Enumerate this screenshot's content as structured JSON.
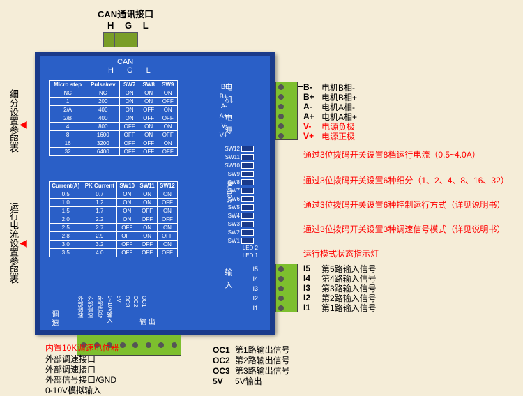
{
  "top": {
    "can": "CAN通讯接口",
    "hgl": "H G L"
  },
  "board": {
    "can": "CAN",
    "hgl": "H G L",
    "setting": "Setting"
  },
  "table_microstep": {
    "headers": [
      "Micro step",
      "Pulse/rev",
      "SW7",
      "SW8",
      "SW9"
    ],
    "rows": [
      [
        "NC",
        "NC",
        "ON",
        "ON",
        "ON"
      ],
      [
        "1",
        "200",
        "ON",
        "ON",
        "OFF"
      ],
      [
        "2/A",
        "400",
        "ON",
        "OFF",
        "ON"
      ],
      [
        "2/B",
        "400",
        "ON",
        "OFF",
        "OFF"
      ],
      [
        "4",
        "800",
        "OFF",
        "ON",
        "ON"
      ],
      [
        "8",
        "1600",
        "OFF",
        "ON",
        "OFF"
      ],
      [
        "16",
        "3200",
        "OFF",
        "OFF",
        "ON"
      ],
      [
        "32",
        "6400",
        "OFF",
        "OFF",
        "OFF"
      ]
    ]
  },
  "table_current": {
    "headers": [
      "Current(A)",
      "PK Current",
      "SW10",
      "SW11",
      "SW12"
    ],
    "rows": [
      [
        "0.5",
        "0.7",
        "ON",
        "ON",
        "ON"
      ],
      [
        "1.0",
        "1.2",
        "ON",
        "ON",
        "OFF"
      ],
      [
        "1.5",
        "1.7",
        "ON",
        "OFF",
        "ON"
      ],
      [
        "2.0",
        "2.2",
        "ON",
        "OFF",
        "OFF"
      ],
      [
        "2.5",
        "2.7",
        "OFF",
        "ON",
        "ON"
      ],
      [
        "2.8",
        "2.9",
        "OFF",
        "ON",
        "OFF"
      ],
      [
        "3.0",
        "3.2",
        "OFF",
        "OFF",
        "ON"
      ],
      [
        "3.5",
        "4.0",
        "OFF",
        "OFF",
        "OFF"
      ]
    ]
  },
  "motor_terms": [
    {
      "k": "B-",
      "d": "电机B相-"
    },
    {
      "k": "B+",
      "d": "电机B相+"
    },
    {
      "k": "A-",
      "d": "电机A相-"
    },
    {
      "k": "A+",
      "d": "电机A相+"
    },
    {
      "k": "V-",
      "d": "电源负极",
      "red": true
    },
    {
      "k": "V+",
      "d": "电源正极",
      "red": true
    }
  ],
  "sw_names": [
    "SW12",
    "SW11",
    "SW10",
    "SW9",
    "SW8",
    "SW7",
    "SW6",
    "SW5",
    "SW4",
    "SW3",
    "SW2",
    "SW1"
  ],
  "leds": [
    "LED 2",
    "LED 1"
  ],
  "sw_ann": [
    "通过3位拨码开关设置8档运行电流（0.5~4.0A）",
    "通过3位拨码开关设置6种细分（1、2、4、8、16、32）",
    "通过3位拨码开关设置6种控制运行方式（详见说明书）",
    "通过3位拨码开关设置3种调速信号模式（详见说明书）",
    "运行模式状态指示灯"
  ],
  "inputs": [
    {
      "k": "I5",
      "d": "第5路输入信号"
    },
    {
      "k": "I4",
      "d": "第4路输入信号"
    },
    {
      "k": "I3",
      "d": "第3路输入信号"
    },
    {
      "k": "I2",
      "d": "第2路输入信号"
    },
    {
      "k": "I1",
      "d": "第1路输入信号"
    }
  ],
  "board_io_input": [
    "I5",
    "I4",
    "I3",
    "I2",
    "I1"
  ],
  "board_cn": {
    "motor": "电 机",
    "power": "电 源",
    "input": "输 入",
    "speed": "调 速",
    "output": "输 出"
  },
  "btm_labels": [
    "外部调速",
    "外部调速",
    "外部信号",
    "0~10V输入",
    "5V",
    "OC3",
    "OC2",
    "OC1"
  ],
  "left_labels": {
    "micro": "细分设置参照表",
    "current": "运行电流设置参照表"
  },
  "btm_ann": {
    "pot": "内置10K调速电位器",
    "lines": [
      "外部调速接口",
      "外部调速接口",
      "外部信号接口/GND",
      "0-10V模拟输入"
    ]
  },
  "btm_out": [
    {
      "k": "OC1",
      "d": "第1路输出信号"
    },
    {
      "k": "OC2",
      "d": "第2路输出信号"
    },
    {
      "k": "OC3",
      "d": "第3路输出信号"
    },
    {
      "k": "5V",
      "d": "5V输出"
    }
  ]
}
